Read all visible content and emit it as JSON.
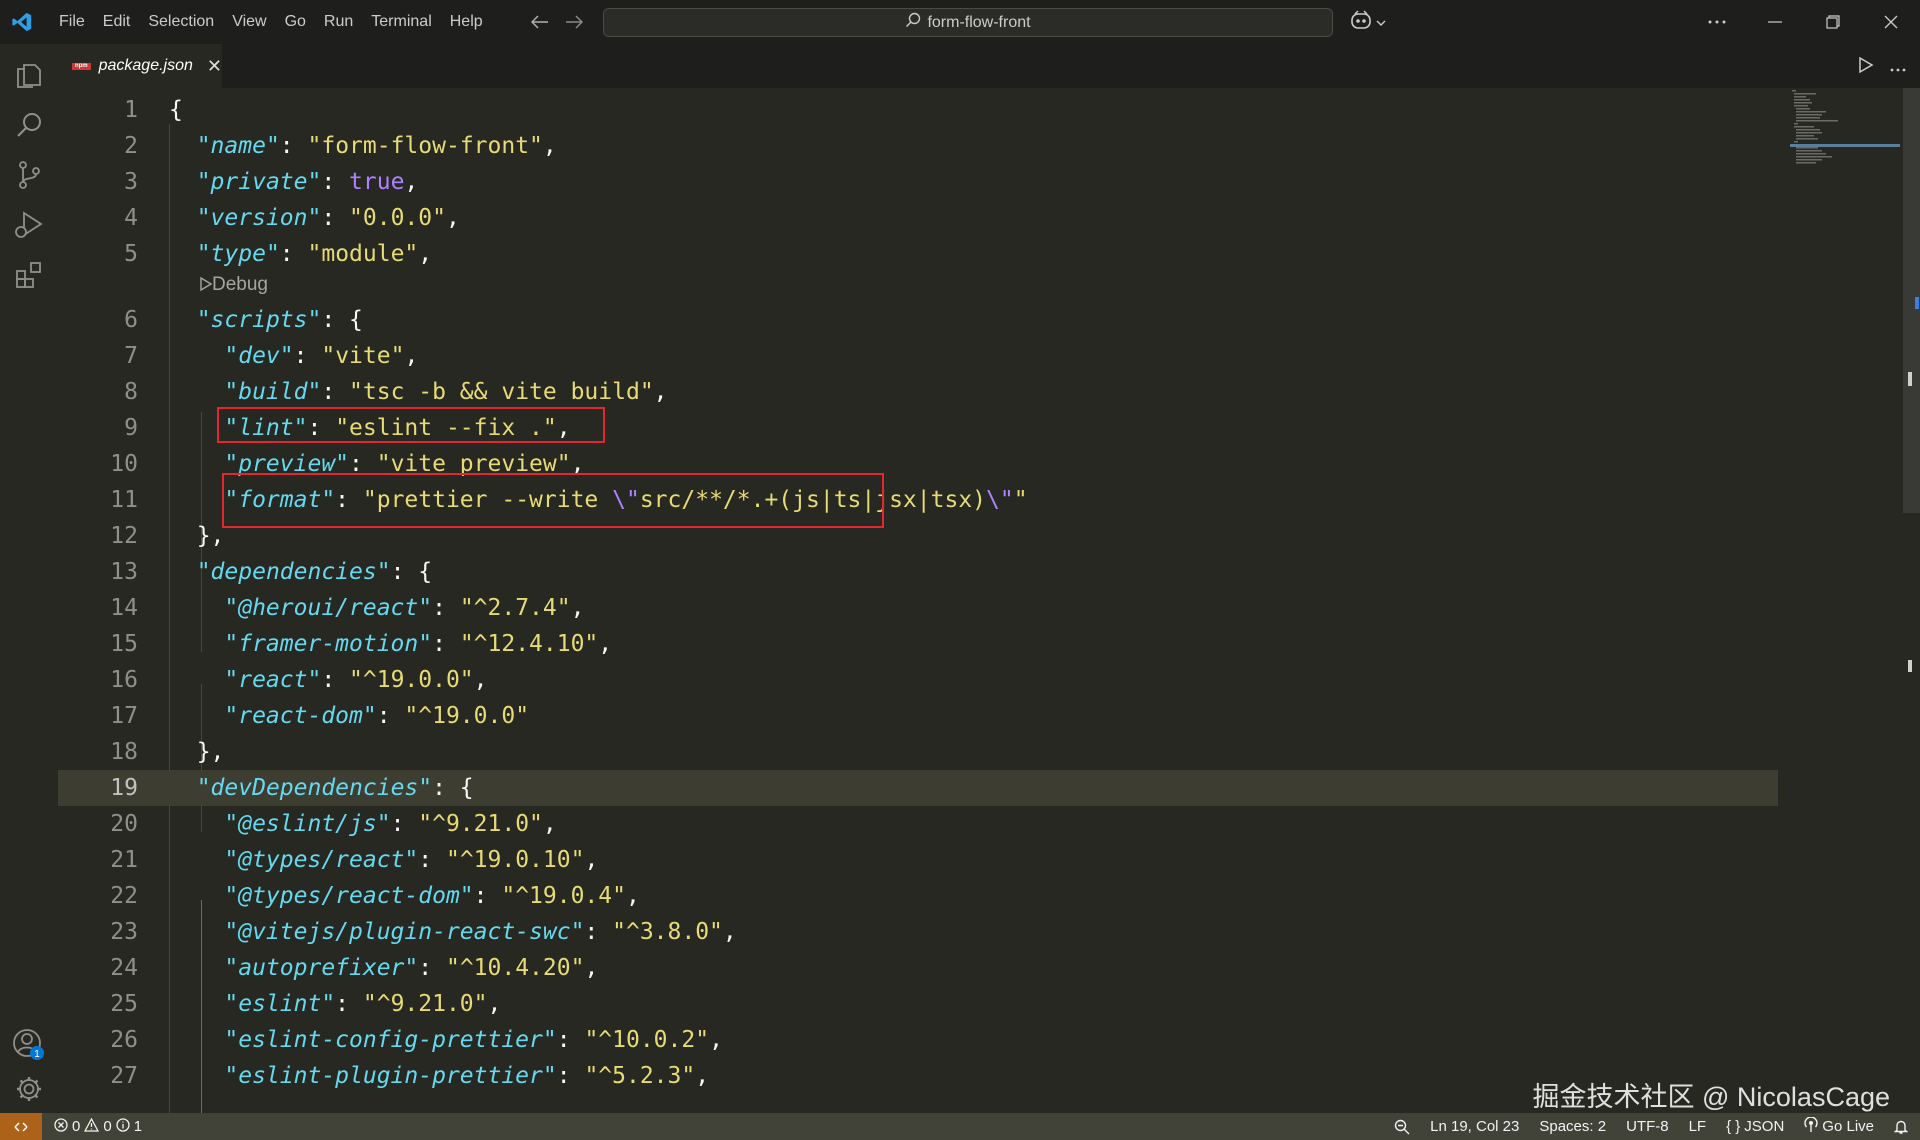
{
  "titlebar": {
    "menu": [
      "File",
      "Edit",
      "Selection",
      "View",
      "Go",
      "Run",
      "Terminal",
      "Help"
    ],
    "search_text": "form-flow-front"
  },
  "tab": {
    "label": "package.json",
    "icon_text": "npm"
  },
  "codelens": {
    "label": "Debug"
  },
  "editor": {
    "lines": [
      {
        "n": "1",
        "tokens": [
          {
            "t": "{",
            "c": "punc"
          }
        ]
      },
      {
        "n": "2",
        "tokens": [
          {
            "t": "  ",
            "c": "punc"
          },
          {
            "t": "\"name\"",
            "c": "key"
          },
          {
            "t": ": ",
            "c": "punc"
          },
          {
            "t": "\"form-flow-front\"",
            "c": "str"
          },
          {
            "t": ",",
            "c": "punc"
          }
        ]
      },
      {
        "n": "3",
        "tokens": [
          {
            "t": "  ",
            "c": "punc"
          },
          {
            "t": "\"private\"",
            "c": "key"
          },
          {
            "t": ": ",
            "c": "punc"
          },
          {
            "t": "true",
            "c": "bool"
          },
          {
            "t": ",",
            "c": "punc"
          }
        ]
      },
      {
        "n": "4",
        "tokens": [
          {
            "t": "  ",
            "c": "punc"
          },
          {
            "t": "\"version\"",
            "c": "key"
          },
          {
            "t": ": ",
            "c": "punc"
          },
          {
            "t": "\"0.0.0\"",
            "c": "str"
          },
          {
            "t": ",",
            "c": "punc"
          }
        ]
      },
      {
        "n": "5",
        "tokens": [
          {
            "t": "  ",
            "c": "punc"
          },
          {
            "t": "\"type\"",
            "c": "key"
          },
          {
            "t": ": ",
            "c": "punc"
          },
          {
            "t": "\"module\"",
            "c": "str"
          },
          {
            "t": ",",
            "c": "punc"
          }
        ]
      },
      {
        "n": "6",
        "tokens": [
          {
            "t": "  ",
            "c": "punc"
          },
          {
            "t": "\"scripts\"",
            "c": "key"
          },
          {
            "t": ": {",
            "c": "punc"
          }
        ]
      },
      {
        "n": "7",
        "tokens": [
          {
            "t": "    ",
            "c": "punc"
          },
          {
            "t": "\"dev\"",
            "c": "key"
          },
          {
            "t": ": ",
            "c": "punc"
          },
          {
            "t": "\"vite\"",
            "c": "str"
          },
          {
            "t": ",",
            "c": "punc"
          }
        ]
      },
      {
        "n": "8",
        "tokens": [
          {
            "t": "    ",
            "c": "punc"
          },
          {
            "t": "\"build\"",
            "c": "key"
          },
          {
            "t": ": ",
            "c": "punc"
          },
          {
            "t": "\"tsc -b && vite build\"",
            "c": "str"
          },
          {
            "t": ",",
            "c": "punc"
          }
        ]
      },
      {
        "n": "9",
        "tokens": [
          {
            "t": "    ",
            "c": "punc"
          },
          {
            "t": "\"lint\"",
            "c": "key"
          },
          {
            "t": ": ",
            "c": "punc"
          },
          {
            "t": "\"eslint --fix .\"",
            "c": "str"
          },
          {
            "t": ",",
            "c": "punc"
          }
        ]
      },
      {
        "n": "10",
        "tokens": [
          {
            "t": "    ",
            "c": "punc"
          },
          {
            "t": "\"preview\"",
            "c": "key"
          },
          {
            "t": ": ",
            "c": "punc"
          },
          {
            "t": "\"vite preview\"",
            "c": "str"
          },
          {
            "t": ",",
            "c": "punc"
          }
        ]
      },
      {
        "n": "11",
        "tokens": [
          {
            "t": "    ",
            "c": "punc"
          },
          {
            "t": "\"format\"",
            "c": "key"
          },
          {
            "t": ": ",
            "c": "punc"
          },
          {
            "t": "\"prettier --write ",
            "c": "str"
          },
          {
            "t": "\\\"",
            "c": "esc"
          },
          {
            "t": "src/**/*.+(js|ts|jsx|tsx)",
            "c": "str"
          },
          {
            "t": "\\\"",
            "c": "esc"
          },
          {
            "t": "\"",
            "c": "str"
          }
        ]
      },
      {
        "n": "12",
        "tokens": [
          {
            "t": "  },",
            "c": "punc"
          }
        ]
      },
      {
        "n": "13",
        "tokens": [
          {
            "t": "  ",
            "c": "punc"
          },
          {
            "t": "\"dependencies\"",
            "c": "key"
          },
          {
            "t": ": {",
            "c": "punc"
          }
        ]
      },
      {
        "n": "14",
        "tokens": [
          {
            "t": "    ",
            "c": "punc"
          },
          {
            "t": "\"@heroui/react\"",
            "c": "key"
          },
          {
            "t": ": ",
            "c": "punc"
          },
          {
            "t": "\"^2.7.4\"",
            "c": "str"
          },
          {
            "t": ",",
            "c": "punc"
          }
        ]
      },
      {
        "n": "15",
        "tokens": [
          {
            "t": "    ",
            "c": "punc"
          },
          {
            "t": "\"framer-motion\"",
            "c": "key"
          },
          {
            "t": ": ",
            "c": "punc"
          },
          {
            "t": "\"^12.4.10\"",
            "c": "str"
          },
          {
            "t": ",",
            "c": "punc"
          }
        ]
      },
      {
        "n": "16",
        "tokens": [
          {
            "t": "    ",
            "c": "punc"
          },
          {
            "t": "\"react\"",
            "c": "key"
          },
          {
            "t": ": ",
            "c": "punc"
          },
          {
            "t": "\"^19.0.0\"",
            "c": "str"
          },
          {
            "t": ",",
            "c": "punc"
          }
        ]
      },
      {
        "n": "17",
        "tokens": [
          {
            "t": "    ",
            "c": "punc"
          },
          {
            "t": "\"react-dom\"",
            "c": "key"
          },
          {
            "t": ": ",
            "c": "punc"
          },
          {
            "t": "\"^19.0.0\"",
            "c": "str"
          }
        ]
      },
      {
        "n": "18",
        "tokens": [
          {
            "t": "  },",
            "c": "punc"
          }
        ]
      },
      {
        "n": "19",
        "tokens": [
          {
            "t": "  ",
            "c": "punc"
          },
          {
            "t": "\"devDependencies\"",
            "c": "key"
          },
          {
            "t": ": {",
            "c": "punc"
          }
        ]
      },
      {
        "n": "20",
        "tokens": [
          {
            "t": "    ",
            "c": "punc"
          },
          {
            "t": "\"@eslint/js\"",
            "c": "key"
          },
          {
            "t": ": ",
            "c": "punc"
          },
          {
            "t": "\"^9.21.0\"",
            "c": "str"
          },
          {
            "t": ",",
            "c": "punc"
          }
        ]
      },
      {
        "n": "21",
        "tokens": [
          {
            "t": "    ",
            "c": "punc"
          },
          {
            "t": "\"@types/react\"",
            "c": "key"
          },
          {
            "t": ": ",
            "c": "punc"
          },
          {
            "t": "\"^19.0.10\"",
            "c": "str"
          },
          {
            "t": ",",
            "c": "punc"
          }
        ]
      },
      {
        "n": "22",
        "tokens": [
          {
            "t": "    ",
            "c": "punc"
          },
          {
            "t": "\"@types/react-dom\"",
            "c": "key"
          },
          {
            "t": ": ",
            "c": "punc"
          },
          {
            "t": "\"^19.0.4\"",
            "c": "str"
          },
          {
            "t": ",",
            "c": "punc"
          }
        ]
      },
      {
        "n": "23",
        "tokens": [
          {
            "t": "    ",
            "c": "punc"
          },
          {
            "t": "\"@vitejs/plugin-react-swc\"",
            "c": "key"
          },
          {
            "t": ": ",
            "c": "punc"
          },
          {
            "t": "\"^3.8.0\"",
            "c": "str"
          },
          {
            "t": ",",
            "c": "punc"
          }
        ]
      },
      {
        "n": "24",
        "tokens": [
          {
            "t": "    ",
            "c": "punc"
          },
          {
            "t": "\"autoprefixer\"",
            "c": "key"
          },
          {
            "t": ": ",
            "c": "punc"
          },
          {
            "t": "\"^10.4.20\"",
            "c": "str"
          },
          {
            "t": ",",
            "c": "punc"
          }
        ]
      },
      {
        "n": "25",
        "tokens": [
          {
            "t": "    ",
            "c": "punc"
          },
          {
            "t": "\"eslint\"",
            "c": "key"
          },
          {
            "t": ": ",
            "c": "punc"
          },
          {
            "t": "\"^9.21.0\"",
            "c": "str"
          },
          {
            "t": ",",
            "c": "punc"
          }
        ]
      },
      {
        "n": "26",
        "tokens": [
          {
            "t": "    ",
            "c": "punc"
          },
          {
            "t": "\"eslint-config-prettier\"",
            "c": "key"
          },
          {
            "t": ": ",
            "c": "punc"
          },
          {
            "t": "\"^10.0.2\"",
            "c": "str"
          },
          {
            "t": ",",
            "c": "punc"
          }
        ]
      },
      {
        "n": "27",
        "tokens": [
          {
            "t": "    ",
            "c": "punc"
          },
          {
            "t": "\"eslint-plugin-prettier\"",
            "c": "key"
          },
          {
            "t": ": ",
            "c": "punc"
          },
          {
            "t": "\"^5.2.3\"",
            "c": "str"
          },
          {
            "t": ",",
            "c": "punc"
          }
        ]
      }
    ]
  },
  "watermark": "掘金技术社区 @ NicolasCage",
  "accounts_badge": "1",
  "status": {
    "errors": "0",
    "warnings": "0",
    "info": "1",
    "position": "Ln 19, Col 23",
    "spaces": "Spaces: 2",
    "encoding": "UTF-8",
    "eol": "LF",
    "language": "JSON",
    "golive": "Go Live"
  },
  "colors": {
    "accent_highlight": "#e0282e",
    "key": "#66d9ef",
    "string": "#e6db74",
    "boolean": "#ae81ff",
    "background": "#272822",
    "statusbar": "#414339",
    "remote": "#ac6218"
  }
}
